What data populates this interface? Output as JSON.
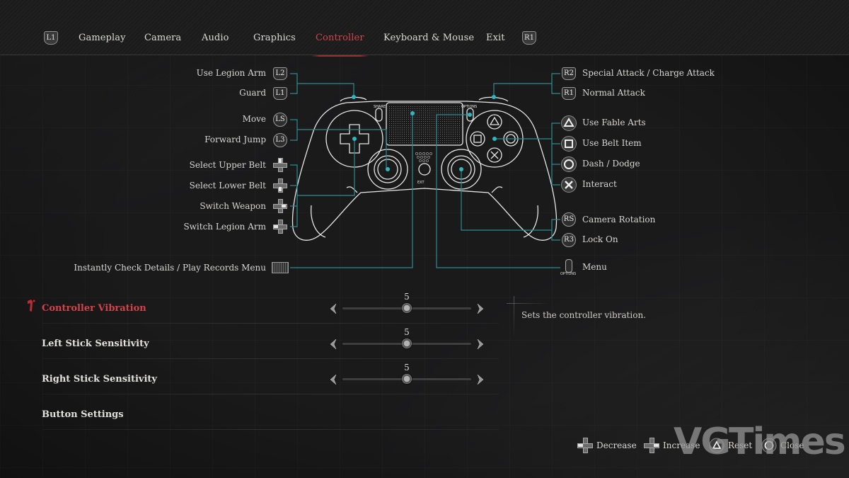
{
  "nav": {
    "left_shoulder": "L1",
    "right_shoulder": "R1",
    "tabs": [
      {
        "label": "Gameplay",
        "active": false
      },
      {
        "label": "Camera",
        "active": false
      },
      {
        "label": "Audio",
        "active": false
      },
      {
        "label": "Graphics",
        "active": false
      },
      {
        "label": "Controller",
        "active": true
      },
      {
        "label": "Keyboard & Mouse",
        "active": false
      },
      {
        "label": "Exit",
        "active": false
      }
    ]
  },
  "controller_map": {
    "left": [
      {
        "action": "Use Legion Arm",
        "button": "L2",
        "glyph": "shield"
      },
      {
        "action": "Guard",
        "button": "L1",
        "glyph": "shield"
      },
      {
        "action": "Move",
        "button": "LS",
        "glyph": "stick"
      },
      {
        "action": "Forward Jump",
        "button": "L3",
        "glyph": "round"
      },
      {
        "action": "Select Upper Belt",
        "button": "D-Pad Up",
        "glyph": "dpad-up"
      },
      {
        "action": "Select Lower Belt",
        "button": "D-Pad Down",
        "glyph": "dpad-down"
      },
      {
        "action": "Switch Weapon",
        "button": "D-Pad Right",
        "glyph": "dpad-right"
      },
      {
        "action": "Switch Legion Arm",
        "button": "D-Pad Left",
        "glyph": "dpad-left"
      },
      {
        "action": "Instantly Check Details / Play Records Menu",
        "button": "Touchpad",
        "glyph": "touchpad"
      }
    ],
    "right": [
      {
        "action": "Special Attack / Charge Attack",
        "button": "R2",
        "glyph": "shield"
      },
      {
        "action": "Normal Attack",
        "button": "R1",
        "glyph": "shield"
      },
      {
        "action": "Use Fable Arts",
        "button": "Triangle",
        "glyph": "triangle"
      },
      {
        "action": "Use Belt Item",
        "button": "Square",
        "glyph": "square"
      },
      {
        "action": "Dash / Dodge",
        "button": "Circle",
        "glyph": "circle"
      },
      {
        "action": "Interact",
        "button": "Cross",
        "glyph": "cross"
      },
      {
        "action": "Camera Rotation",
        "button": "RS",
        "glyph": "stick"
      },
      {
        "action": "Lock On",
        "button": "R3",
        "glyph": "round"
      },
      {
        "action": "Menu",
        "button": "OPTIONS",
        "glyph": "options"
      }
    ],
    "controller_labels": {
      "share": "SHARE",
      "options": "OPTIONS",
      "ext": "EXT"
    }
  },
  "settings": [
    {
      "label": "Controller Vibration",
      "value": 5,
      "min": 0,
      "max": 10,
      "selected": true
    },
    {
      "label": "Left Stick Sensitivity",
      "value": 5,
      "min": 0,
      "max": 10,
      "selected": false
    },
    {
      "label": "Right Stick Sensitivity",
      "value": 5,
      "min": 0,
      "max": 10,
      "selected": false
    },
    {
      "label": "Button Settings",
      "selected": false
    }
  ],
  "description": "Sets the controller vibration.",
  "footer": [
    {
      "label": "Decrease",
      "icon": "dpad-left-icon"
    },
    {
      "label": "Increase",
      "icon": "dpad-right-icon"
    },
    {
      "label": "Reset",
      "icon": "triangle-button-icon"
    },
    {
      "label": "Close",
      "icon": "circle-button-icon"
    }
  ],
  "watermark": "VGTimes",
  "colors": {
    "accent": "#d3434a",
    "line": "#2e8a91",
    "dot": "#2fb6c0",
    "text": "#d8d6d2",
    "bg": "#1a1a1b"
  }
}
